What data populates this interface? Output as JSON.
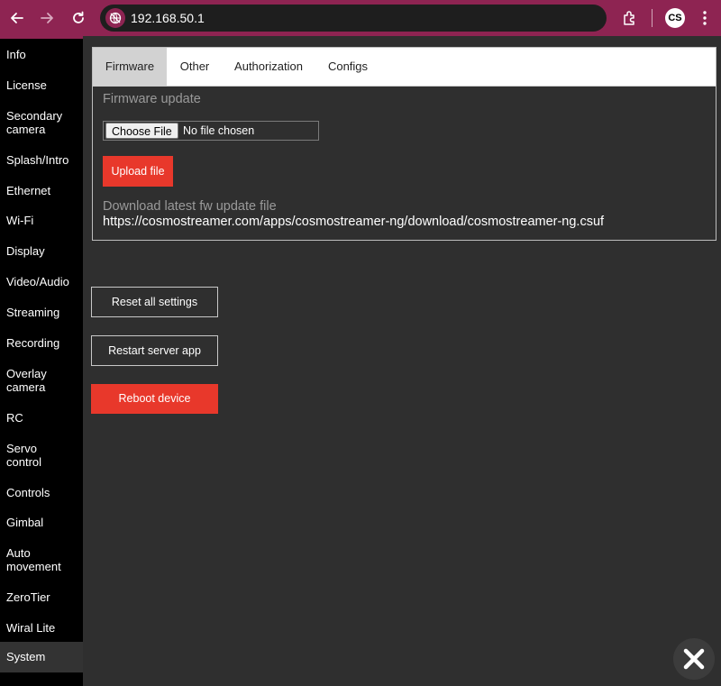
{
  "browser": {
    "address": "192.168.50.1",
    "profile_initials": "CS"
  },
  "sidebar": {
    "items": [
      {
        "label": "Info"
      },
      {
        "label": "License"
      },
      {
        "label": "Secondary camera"
      },
      {
        "label": "Splash/Intro"
      },
      {
        "label": "Ethernet"
      },
      {
        "label": "Wi-Fi"
      },
      {
        "label": "Display"
      },
      {
        "label": "Video/Audio"
      },
      {
        "label": "Streaming"
      },
      {
        "label": "Recording"
      },
      {
        "label": "Overlay camera"
      },
      {
        "label": "RC"
      },
      {
        "label": "Servo control"
      },
      {
        "label": "Controls"
      },
      {
        "label": "Gimbal"
      },
      {
        "label": "Auto movement"
      },
      {
        "label": "ZeroTier"
      },
      {
        "label": "Wiral Lite"
      },
      {
        "label": "System"
      }
    ],
    "active": "System"
  },
  "tabs": [
    {
      "label": "Firmware"
    },
    {
      "label": "Other"
    },
    {
      "label": "Authorization"
    },
    {
      "label": "Configs"
    }
  ],
  "firmware": {
    "section_title": "Firmware update",
    "choose_file_label": "Choose File",
    "file_status": "No file chosen",
    "upload_label": "Upload file",
    "download_title": "Download latest fw update file",
    "download_url": "https://cosmostreamer.com/apps/cosmostreamer-ng/download/cosmostreamer-ng.csuf"
  },
  "actions": {
    "reset_label": "Reset all settings",
    "restart_label": "Restart server app",
    "reboot_label": "Reboot device"
  },
  "colors": {
    "accent": "#e8382b",
    "browser_frame": "#8e2452",
    "sidebar_bg": "#000000",
    "main_bg": "#2f2f2f"
  }
}
